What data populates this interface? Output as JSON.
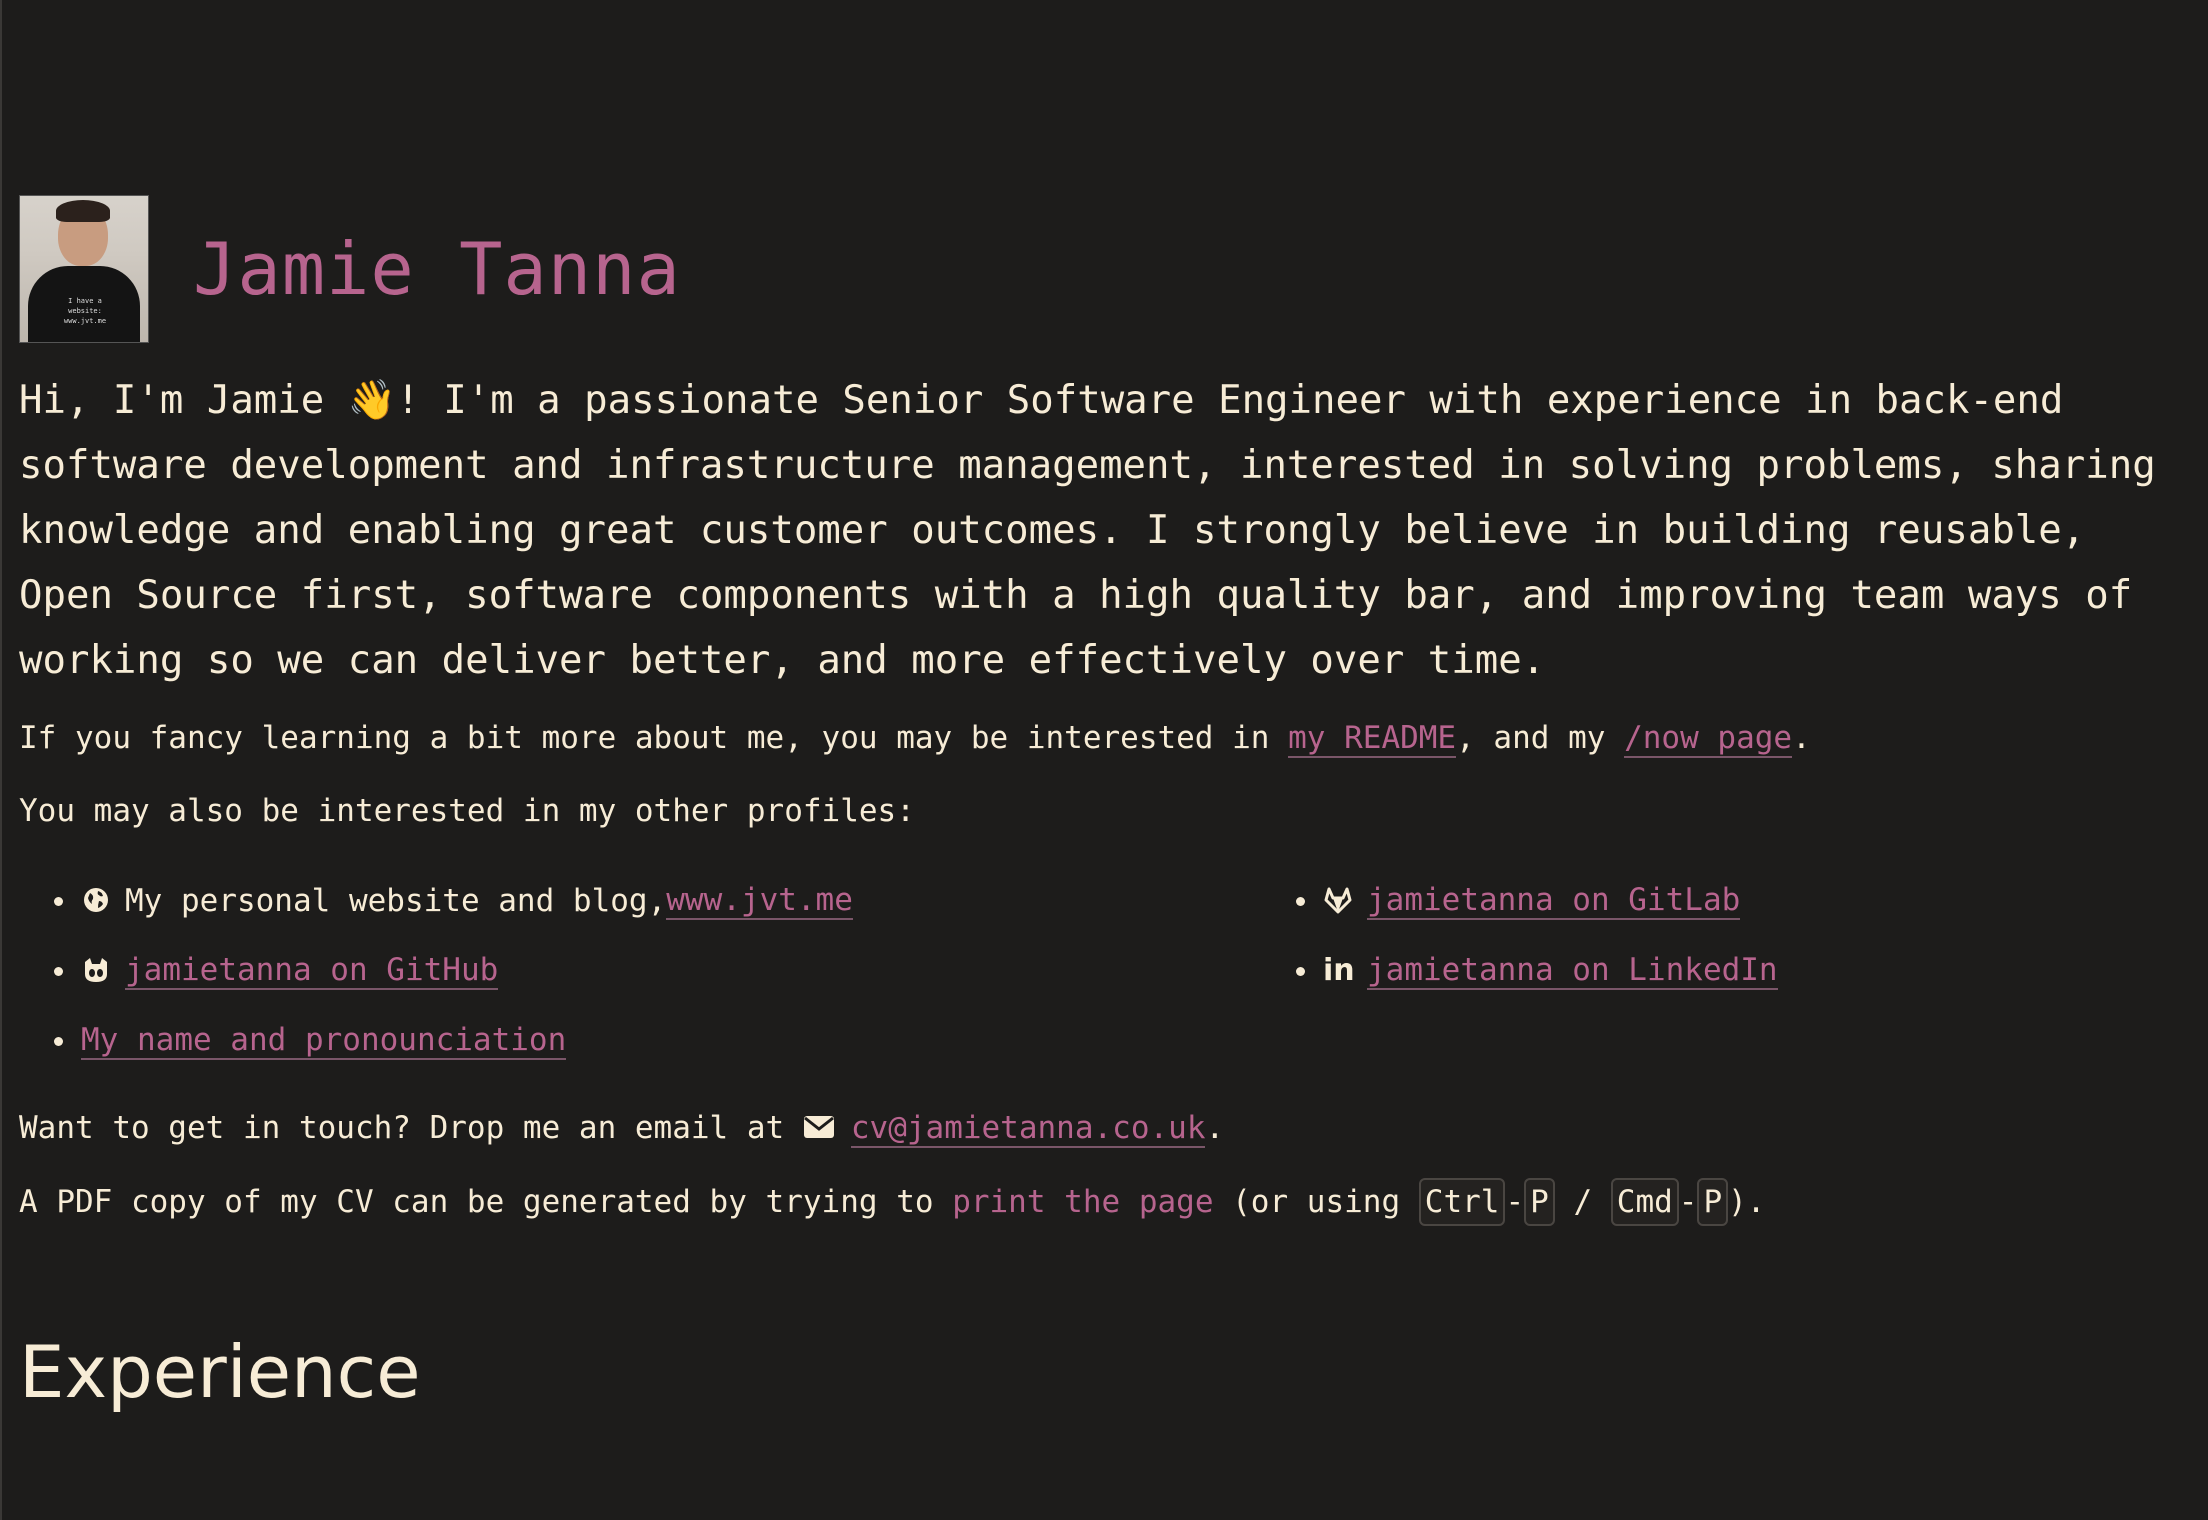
{
  "header": {
    "name": "Jamie Tanna",
    "avatar_shirt_text_line1": "I have a website:",
    "avatar_shirt_text_line2": "www.jvt.me"
  },
  "intro": {
    "text_before_emoji": "Hi, I'm Jamie ",
    "emoji": "👋",
    "text_after_emoji": "! I'm a passionate Senior Software Engineer with experience in back-end software development and infrastructure management, interested in solving problems, sharing knowledge and enabling great customer outcomes. I strongly believe in building reusable, Open Source first, software components with a high quality bar, and improving team ways of working so we can deliver better, and more effectively over time."
  },
  "learn_more": {
    "prefix": "If you fancy learning a bit more about me, you may be interested in ",
    "readme_link": "my README",
    "middle": ", and my ",
    "now_link": "/now page",
    "suffix": "."
  },
  "profiles": {
    "heading": "You may also be interested in my other profiles:",
    "website_prefix": "My personal website and blog, ",
    "website_link": "www.jvt.me",
    "gitlab_link": "jamietanna on GitLab",
    "github_link": "jamietanna on GitHub",
    "linkedin_link": "jamietanna on LinkedIn",
    "linkedin_icon_text": "in",
    "pronunciation_link": "My name and pronounciation"
  },
  "contact": {
    "prefix": "Want to get in touch? Drop me an email at ",
    "email": "cv@jamietanna.co.uk",
    "suffix": "."
  },
  "pdf": {
    "prefix": "A PDF copy of my CV can be generated by trying to ",
    "print_link": "print the page",
    "middle": " (or using ",
    "key_ctrl": "Ctrl",
    "dash1": "-",
    "key_p1": "P",
    "slash": " / ",
    "key_cmd": "Cmd",
    "dash2": "-",
    "key_p2": "P",
    "suffix": ")."
  },
  "sections": {
    "experience": "Experience"
  }
}
